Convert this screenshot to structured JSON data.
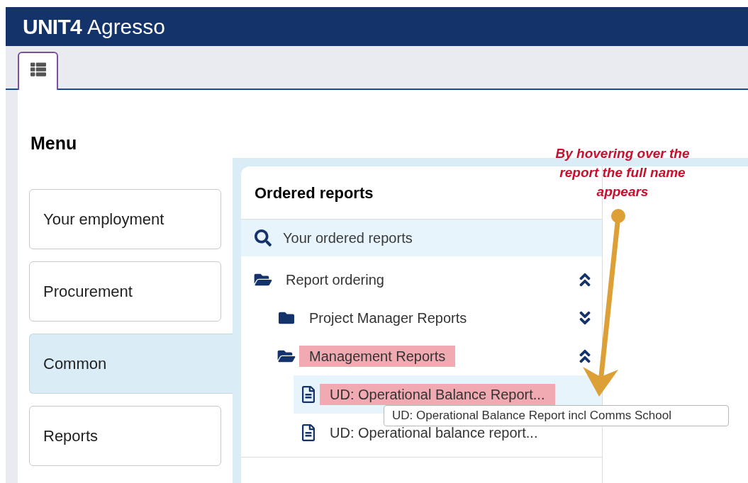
{
  "header": {
    "brand": "UNIT4",
    "product": "Agresso"
  },
  "menu": {
    "title": "Menu",
    "items": [
      {
        "label": "Your employment",
        "selected": false
      },
      {
        "label": "Procurement",
        "selected": false
      },
      {
        "label": "Common",
        "selected": true
      },
      {
        "label": "Reports",
        "selected": false
      }
    ]
  },
  "panel": {
    "title": "Ordered reports",
    "search_item": "Your ordered reports",
    "tree": [
      {
        "label": "Report ordering",
        "kind": "folder",
        "expanded": true,
        "highlighted": false,
        "hovered": false,
        "children": [
          {
            "label": "Project Manager Reports",
            "kind": "folder",
            "expanded": false,
            "highlighted": false,
            "hovered": false
          },
          {
            "label": "Management Reports",
            "kind": "folder",
            "expanded": true,
            "highlighted": true,
            "hovered": false,
            "children": [
              {
                "label": "UD: Operational Balance Report...",
                "kind": "report",
                "highlighted": true,
                "hovered": true
              },
              {
                "label": "UD: Operational balance report...",
                "kind": "report",
                "highlighted": false,
                "hovered": false
              }
            ]
          }
        ]
      }
    ]
  },
  "tooltip": "UD: Operational Balance Report incl Comms School",
  "annotation": "By hovering over the report the full name appears"
}
